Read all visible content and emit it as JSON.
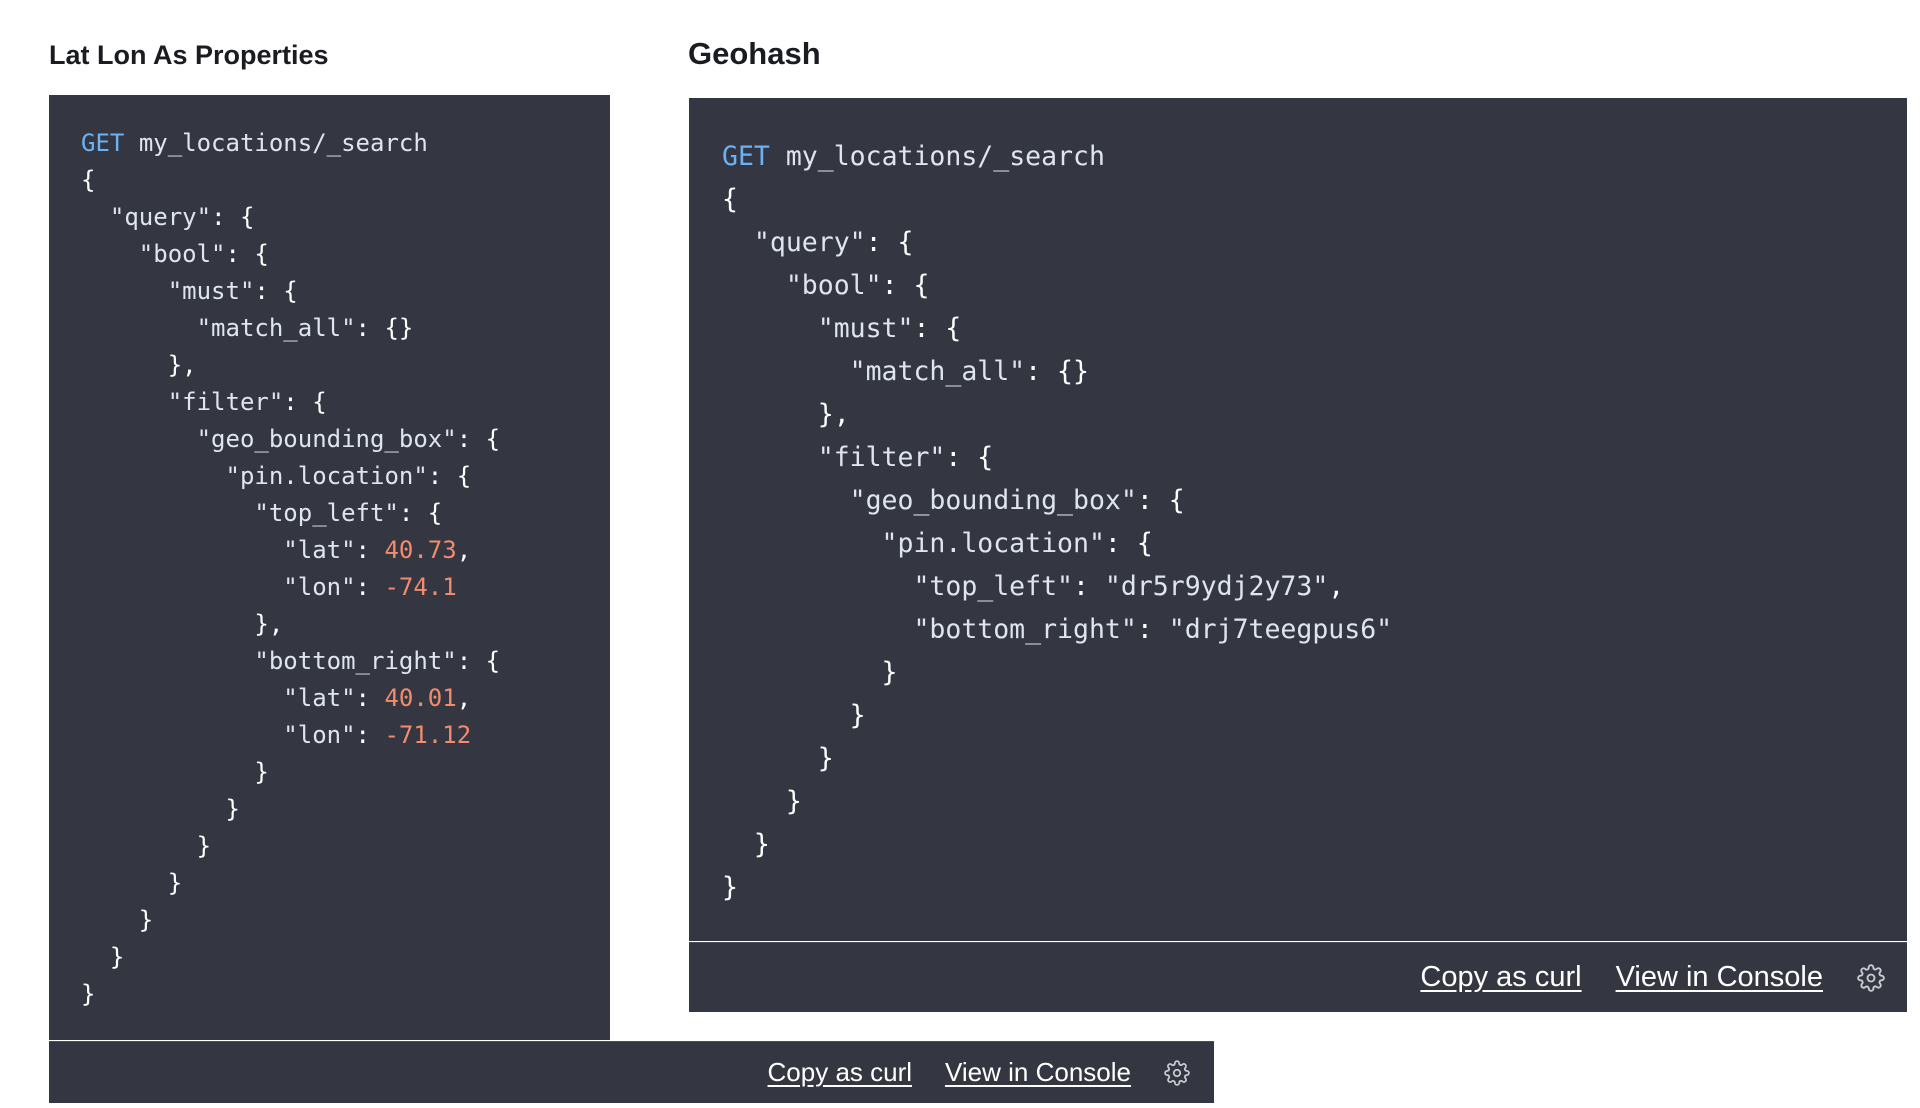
{
  "left_example": {
    "heading": "Lat Lon As Properties",
    "request": {
      "method": "GET",
      "path": "my_locations/_search"
    },
    "code": {
      "l1": "{",
      "l2_key": "\"query\"",
      "l2_rest": ": {",
      "l3_key": "\"bool\"",
      "l3_rest": ": {",
      "l4_key": "\"must\"",
      "l4_rest": ": {",
      "l5_key": "\"match_all\"",
      "l5_rest": ": {}",
      "l6": "},",
      "l7_key": "\"filter\"",
      "l7_rest": ": {",
      "l8_key": "\"geo_bounding_box\"",
      "l8_rest": ": {",
      "l9_key": "\"pin.location\"",
      "l9_rest": ": {",
      "l10_key": "\"top_left\"",
      "l10_rest": ": {",
      "l11_key": "\"lat\"",
      "l11_sep": ": ",
      "l11_val": "40.73",
      "l11_end": ",",
      "l12_key": "\"lon\"",
      "l12_sep": ": ",
      "l12_val": "-74.1",
      "l13": "},",
      "l14_key": "\"bottom_right\"",
      "l14_rest": ": {",
      "l15_key": "\"lat\"",
      "l15_sep": ": ",
      "l15_val": "40.01",
      "l15_end": ",",
      "l16_key": "\"lon\"",
      "l16_sep": ": ",
      "l16_val": "-71.12",
      "l17": "}",
      "l18": "}",
      "l19": "}",
      "l20": "}",
      "l21": "}",
      "l22": "}",
      "l23": "}"
    },
    "footer": {
      "copy_label": "Copy as curl",
      "console_label": "View in Console",
      "settings_icon": "gear-icon"
    }
  },
  "right_example": {
    "heading": "Geohash",
    "request": {
      "method": "GET",
      "path": "my_locations/_search"
    },
    "code": {
      "l1": "{",
      "l2_key": "\"query\"",
      "l2_rest": ": {",
      "l3_key": "\"bool\"",
      "l3_rest": ": {",
      "l4_key": "\"must\"",
      "l4_rest": ": {",
      "l5_key": "\"match_all\"",
      "l5_rest": ": {}",
      "l6": "},",
      "l7_key": "\"filter\"",
      "l7_rest": ": {",
      "l8_key": "\"geo_bounding_box\"",
      "l8_rest": ": {",
      "l9_key": "\"pin.location\"",
      "l9_rest": ": {",
      "l10_key": "\"top_left\"",
      "l10_sep": ": ",
      "l10_val": "\"dr5r9ydj2y73\"",
      "l10_end": ",",
      "l11_key": "\"bottom_right\"",
      "l11_sep": ": ",
      "l11_val": "\"drj7teegpus6\"",
      "l12": "}",
      "l13": "}",
      "l14": "}",
      "l15": "}",
      "l16": "}",
      "l17": "}"
    },
    "footer": {
      "copy_label": "Copy as curl",
      "console_label": "View in Console",
      "settings_icon": "gear-icon"
    }
  },
  "colors": {
    "code_background": "#343741",
    "method": "#6ab2f5",
    "number": "#f38b6c",
    "text": "#dfe5ef"
  }
}
